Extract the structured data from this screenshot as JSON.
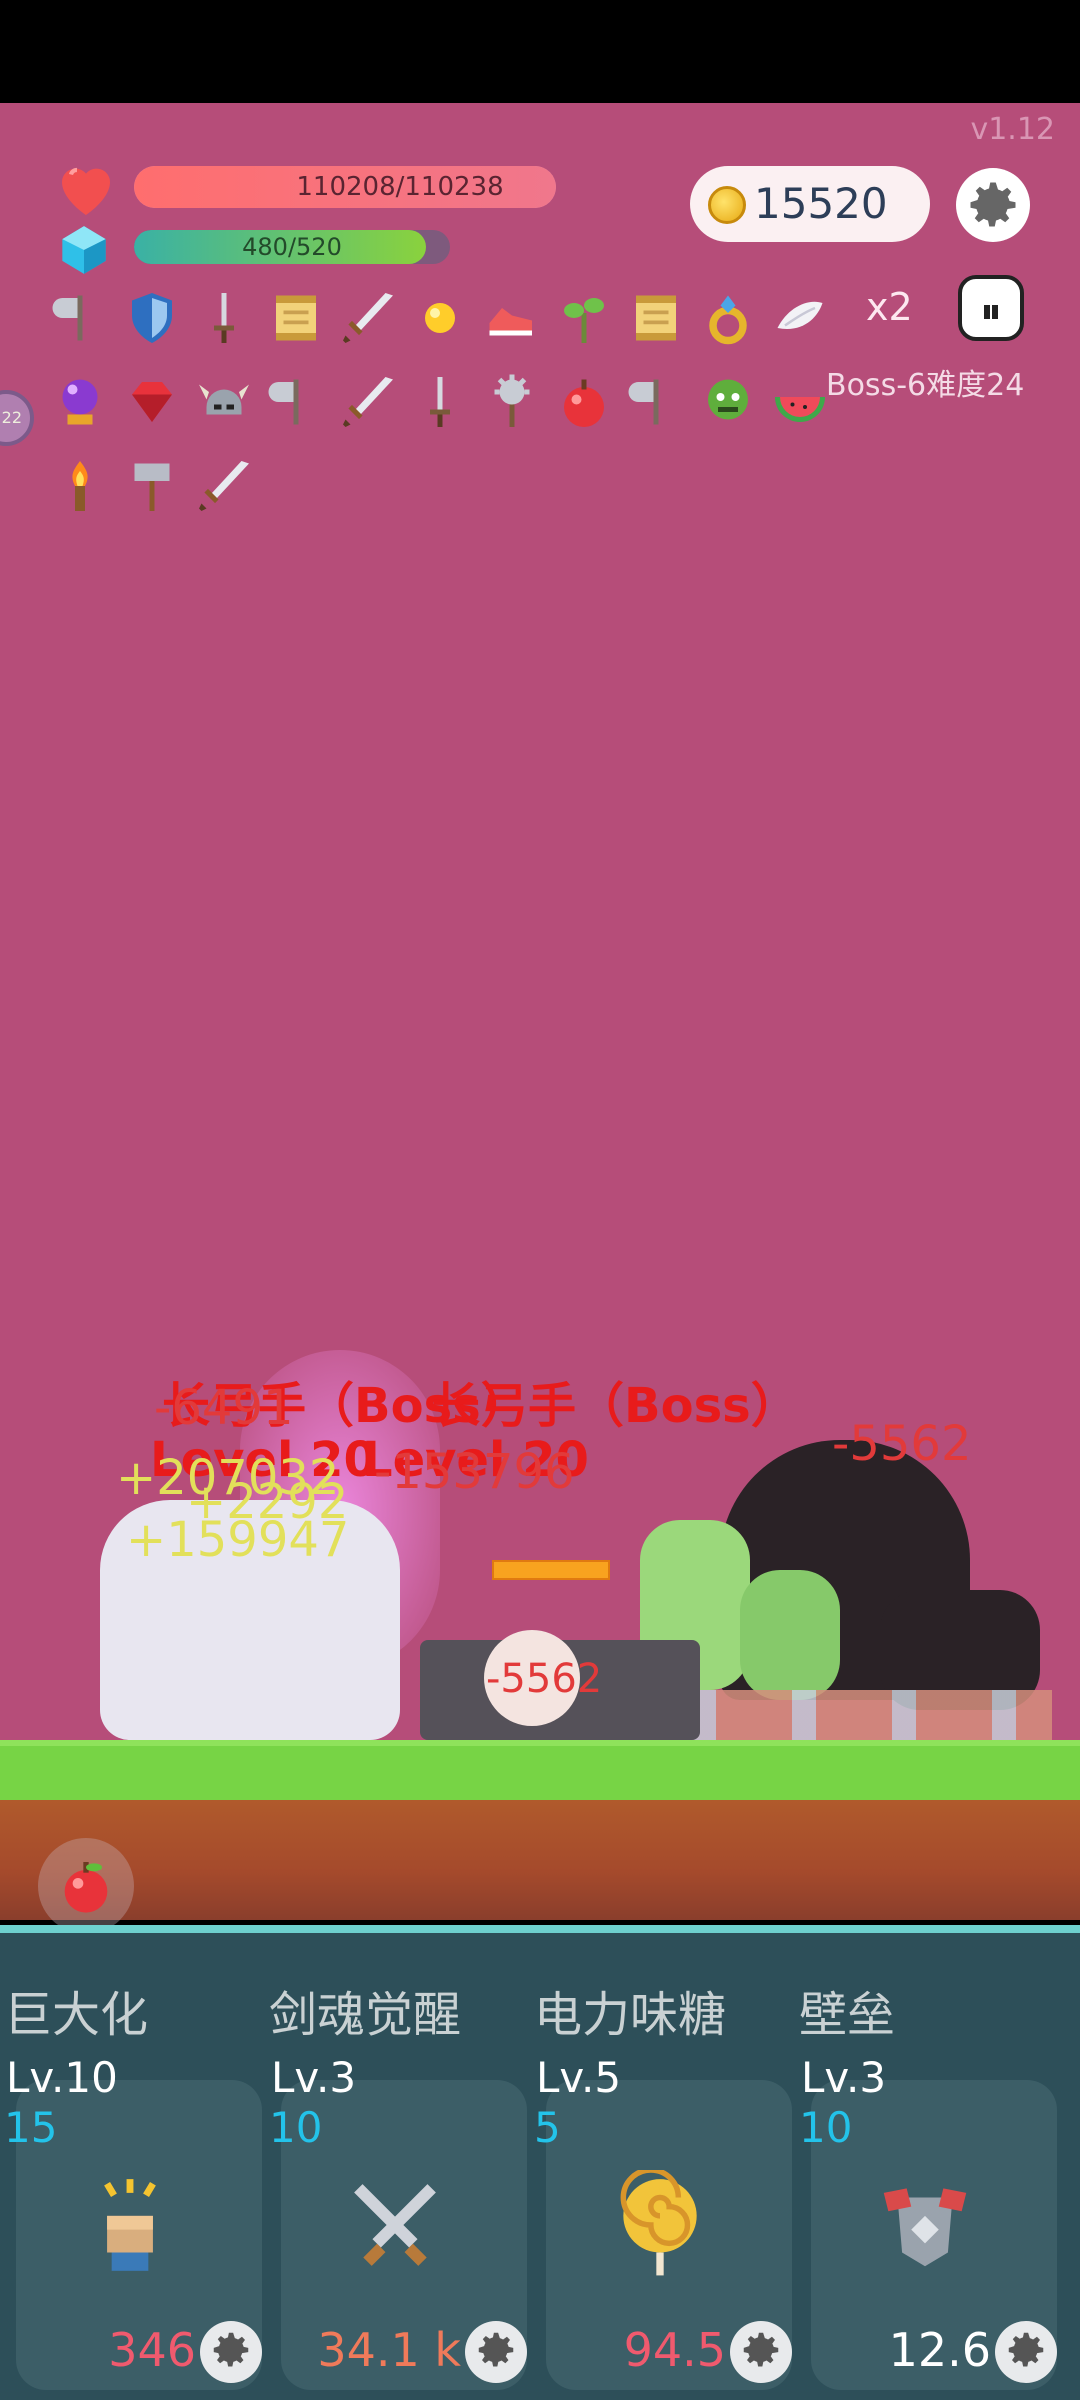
{
  "version": "v1.12",
  "hp": {
    "current": "110208/110238",
    "fill": 0.9997
  },
  "mp": {
    "current": "480/520",
    "fill": 0.923
  },
  "coins": "15520",
  "speed_multiplier": "x2",
  "boss_stage": "Boss-6难度24",
  "side_badge": "22",
  "inventory_rows": [
    [
      "axe-icon",
      "shield-icon",
      "dagger-icon",
      "scroll-icon",
      "sword-icon",
      "sun-orb-icon",
      "sneaker-icon",
      "sapling-icon",
      "scroll-icon",
      "ring-icon",
      "wing-icon"
    ],
    [
      "crystal-ball-icon",
      "ruby-icon",
      "viking-helmet-icon",
      "axe-icon",
      "sword-icon",
      "dagger-icon",
      "mace-icon",
      "apple-icon",
      "axe-icon",
      "zombie-icon",
      "watermelon-icon"
    ],
    [
      "torch-icon",
      "hammer-icon",
      "sword-icon"
    ]
  ],
  "enemy_name_1": "长弓手（Boss）",
  "enemy_name_2": "长弓手（Boss）",
  "enemy_level_1": "Level 20",
  "enemy_level_2": "Level 20",
  "floating_numbers": {
    "dmg_a": "-6491",
    "dmg_b": "-5562",
    "dmg_c": "-5562",
    "dmg_d": "-153796",
    "heal_a": "+207032",
    "heal_b": "+2292",
    "heal_c": "+159947"
  },
  "skills": [
    {
      "name": "巨大化",
      "level": "Lv.10",
      "cost": "15",
      "value": "346",
      "value_color": "#f05a6e",
      "icon": "fist-icon"
    },
    {
      "name": "剑魂觉醒",
      "level": "Lv.3",
      "cost": "10",
      "value": "34.1 k",
      "value_color": "#f07a5a",
      "icon": "crossed-swords-icon"
    },
    {
      "name": "电力味糖",
      "level": "Lv.5",
      "cost": "5",
      "value": "94.5",
      "value_color": "#f05a6e",
      "icon": "lollipop-icon"
    },
    {
      "name": "壁垒",
      "level": "Lv.3",
      "cost": "10",
      "value": "12.6",
      "value_color": "#ffffff",
      "icon": "armor-icon"
    }
  ]
}
